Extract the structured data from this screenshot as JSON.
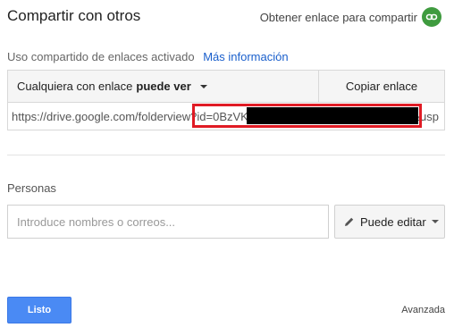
{
  "dialog": {
    "title": "Compartir con otros",
    "get_link_label": "Obtener enlace para compartir"
  },
  "link_sharing": {
    "status_text": "Uso compartido de enlaces activado",
    "more_info": "Más información",
    "who_prefix": "Cualquiera con enlace",
    "who_permission": "puede ver",
    "copy_label": "Copiar enlace",
    "url_visible": "https://drive.google.com/folderview?id=0BzVK",
    "url_suffix": "&usp"
  },
  "people": {
    "label": "Personas",
    "input_placeholder": "Introduce nombres o correos...",
    "permission_label": "Puede editar"
  },
  "footer": {
    "done_label": "Listo",
    "advanced_label": "Avanzada"
  },
  "colors": {
    "link_icon_bg": "#3f9b3f",
    "primary_button": "#4a8af4",
    "highlight_border": "#e01b24"
  }
}
